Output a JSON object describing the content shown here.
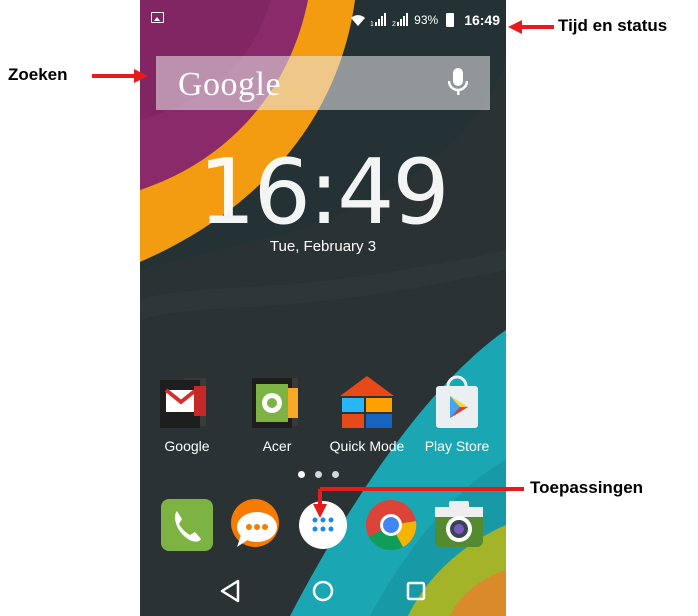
{
  "status_bar": {
    "battery_percent": "93%",
    "time": "16:49",
    "sim1": "1",
    "sim2": "2"
  },
  "search": {
    "logo_text": "Google"
  },
  "clock": {
    "time": "16:49",
    "date": "Tue, February 3"
  },
  "apps": [
    {
      "label": "Google"
    },
    {
      "label": "Acer"
    },
    {
      "label": "Quick Mode"
    },
    {
      "label": "Play Store"
    }
  ],
  "annotations": {
    "status": "Tijd en status",
    "search": "Zoeken",
    "apps": "Toepassingen"
  },
  "colors": {
    "background": "#2c3335",
    "magenta": "#8a2a6a",
    "orange": "#f39c12",
    "teal": "#15a3b0",
    "arrow": "#e61c1c"
  }
}
